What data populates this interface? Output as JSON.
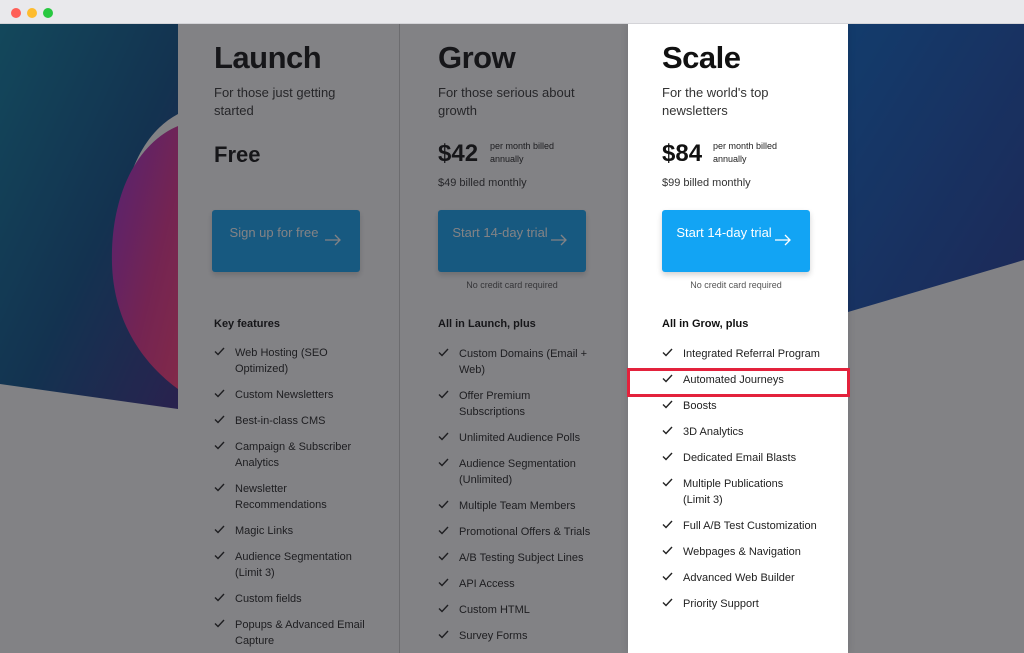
{
  "window": {
    "controls": [
      "close",
      "minimize",
      "maximize"
    ]
  },
  "plans": [
    {
      "name": "Launch",
      "description": "For those just getting started",
      "price": "Free",
      "cta": "Sign up for free",
      "features_heading": "Key features",
      "features": [
        "Web Hosting (SEO Optimized)",
        "Custom Newsletters",
        "Best-in-class CMS",
        "Campaign & Subscriber Analytics",
        "Newsletter Recommendations",
        "Magic Links",
        "Audience Segmentation (Limit 3)",
        "Custom fields",
        "Popups & Advanced Email Capture"
      ]
    },
    {
      "name": "Grow",
      "description": "For those serious about growth",
      "price": "$42",
      "price_note": "per month billed annually",
      "monthly": "$49 billed monthly",
      "cta": "Start 14-day trial",
      "no_card": "No credit card required",
      "features_heading": "All in Launch, plus",
      "features": [
        "Custom Domains (Email + Web)",
        "Offer Premium Subscriptions",
        "Unlimited Audience Polls",
        "Audience Segmentation (Unlimited)",
        "Multiple Team Members",
        "Promotional Offers & Trials",
        "A/B Testing Subject Lines",
        "API Access",
        "Custom HTML",
        "Survey Forms"
      ]
    },
    {
      "name": "Scale",
      "description": "For the world's top newsletters",
      "price": "$84",
      "price_note": "per month billed annually",
      "monthly": "$99 billed monthly",
      "cta": "Start 14-day trial",
      "no_card": "No credit card required",
      "features_heading": "All in Grow, plus",
      "features": [
        "Integrated Referral Program",
        "Automated Journeys",
        "Boosts",
        "3D Analytics",
        "Dedicated Email Blasts",
        "Multiple Publications (Limit 3)",
        "Full A/B Test Customization",
        "Webpages & Navigation",
        "Advanced Web Builder",
        "Priority Support"
      ]
    }
  ],
  "highlighted_feature": "Automated Journeys",
  "colors": {
    "accent": "#12a4f4",
    "highlight": "#e3223c",
    "overlay": "#1c1c20"
  },
  "icons": [
    "checkmark-icon",
    "arrow-right-icon"
  ]
}
